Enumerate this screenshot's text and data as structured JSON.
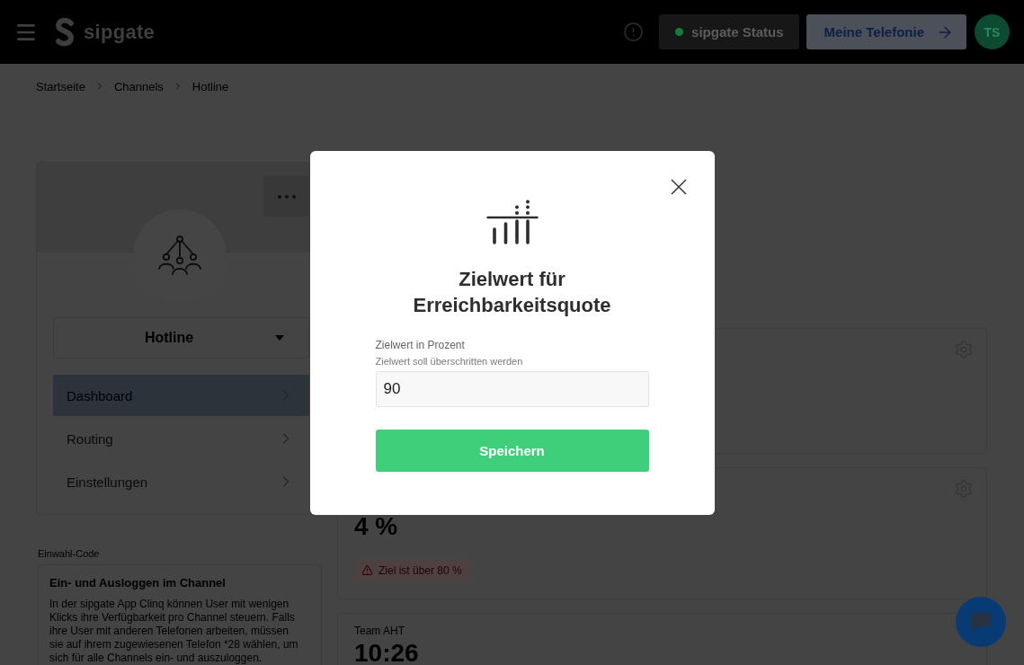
{
  "header": {
    "logo": "sipgate",
    "status_button": "sipgate Status",
    "primary_button": "Meine Telefonie",
    "avatar": "TS"
  },
  "breadcrumbs": [
    "Startseite",
    "Channels",
    "Hotline"
  ],
  "channel_card": {
    "channel_select": "Hotline",
    "nav": [
      {
        "label": "Dashboard",
        "selected": true
      },
      {
        "label": "Routing",
        "selected": false
      },
      {
        "label": "Einstellungen",
        "selected": false
      }
    ]
  },
  "dial_in_code": {
    "label": "Einwahl-Code",
    "title": "Ein- und Ausloggen im Channel",
    "text": "In der sipgate App Clinq können User mit wenigen Klicks ihre Verfügbarkeit pro Channel steuern. Falls ihre User mit anderen Telefonen arbeiten, müssen sie auf ihrem zugewiesenen Telefon *28 wählen, um sich für alle Channels ein- und auszuloggen."
  },
  "metric_cards": [
    {
      "settings": true
    },
    {
      "settings": true,
      "value": "4 %",
      "alert": "Ziel ist über 80 %"
    },
    {
      "title": "Team AHT",
      "value": "10:26"
    }
  ],
  "modal": {
    "title": "Zielwert für Erreichbarkeitsquote",
    "field_label": "Zielwert in Prozent",
    "field_hint": "Zielwert soll überschritten werden",
    "value": "90",
    "save_button": "Speichern"
  }
}
